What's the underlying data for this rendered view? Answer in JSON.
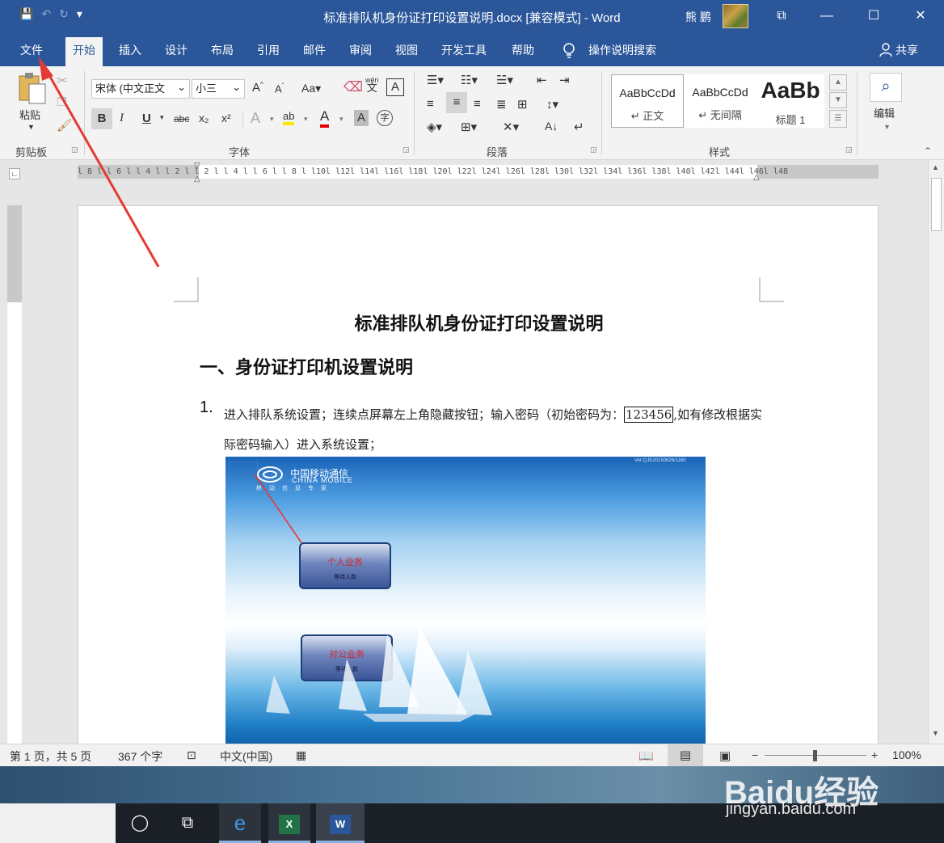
{
  "window": {
    "title": "标准排队机身份证打印设置说明.docx [兼容模式] - Word",
    "user": "熊 鹏",
    "minimize": "—",
    "maximize": "☐",
    "close": "✕",
    "restore": "⧉"
  },
  "qat": {
    "save": "💾",
    "undo": "↶",
    "redo": "↻",
    "more": "▾"
  },
  "tabs": [
    "文件",
    "开始",
    "插入",
    "设计",
    "布局",
    "引用",
    "邮件",
    "审阅",
    "视图",
    "开发工具",
    "帮助"
  ],
  "tab_search": "操作说明搜索",
  "share": "共享",
  "ribbon": {
    "clipboard": {
      "label": "剪贴板",
      "paste": "粘贴"
    },
    "font": {
      "label": "字体",
      "font_name": "宋体 (中文正文",
      "font_size": "小三",
      "aa": "Aa",
      "bold": "B",
      "italic": "I",
      "underline": "U",
      "strike": "abc",
      "sub": "x₂",
      "sup": "x²",
      "wen": "wén",
      "wen_char": "文",
      "a_box": "A",
      "circ": "字"
    },
    "paragraph": {
      "label": "段落"
    },
    "styles": {
      "label": "样式",
      "items": [
        {
          "preview": "AaBbCcDd",
          "name": "↵ 正文"
        },
        {
          "preview": "AaBbCcDd",
          "name": "↵ 无间隔"
        },
        {
          "preview": "AaBb",
          "name": "标题 1"
        }
      ]
    },
    "editing": {
      "label": "编辑"
    }
  },
  "ruler": "l 8 l   l 6 l   l 4 l   l 2 l        l 2 l   l 4 l   l 6 l   l 8 l  l10l  l12l  l14l  l16l  l18l  l20l  l22l  l24l  l26l  l28l  l30l  l32l  l34l  l36l  l38l  l40l  l42l  l44l  l46l  l48",
  "document": {
    "title": "标准排队机身份证打印设置说明",
    "heading": "一、身份证打印机设置说明",
    "item_number": "1.",
    "para_before": "进入排队系统设置；连续点屏幕左上角隐藏按钮；输入密码（初始密码为：",
    "password": "123456",
    "para_after": ",如有修改根据实际密码输入）进入系统设置；",
    "screenshot": {
      "logo": "中国移动通信",
      "logo_en": "CHINA MOBILE",
      "tagline": "移动信息专家",
      "version": "Ver:QJE20150626/1160",
      "button1_title": "个人业务",
      "button1_sub": "等待人数",
      "button2_title": "对公业务",
      "button2_sub": "等待人数"
    }
  },
  "status": {
    "page": "第 1 页，共 5 页",
    "words": "367 个字",
    "language": "中文(中国)",
    "zoom": "100%"
  },
  "watermark": {
    "brand": "Baidu经验",
    "url": "jingyan.baidu.com"
  },
  "colors": {
    "word_blue": "#2b579a",
    "annotation_red": "#e53935"
  }
}
